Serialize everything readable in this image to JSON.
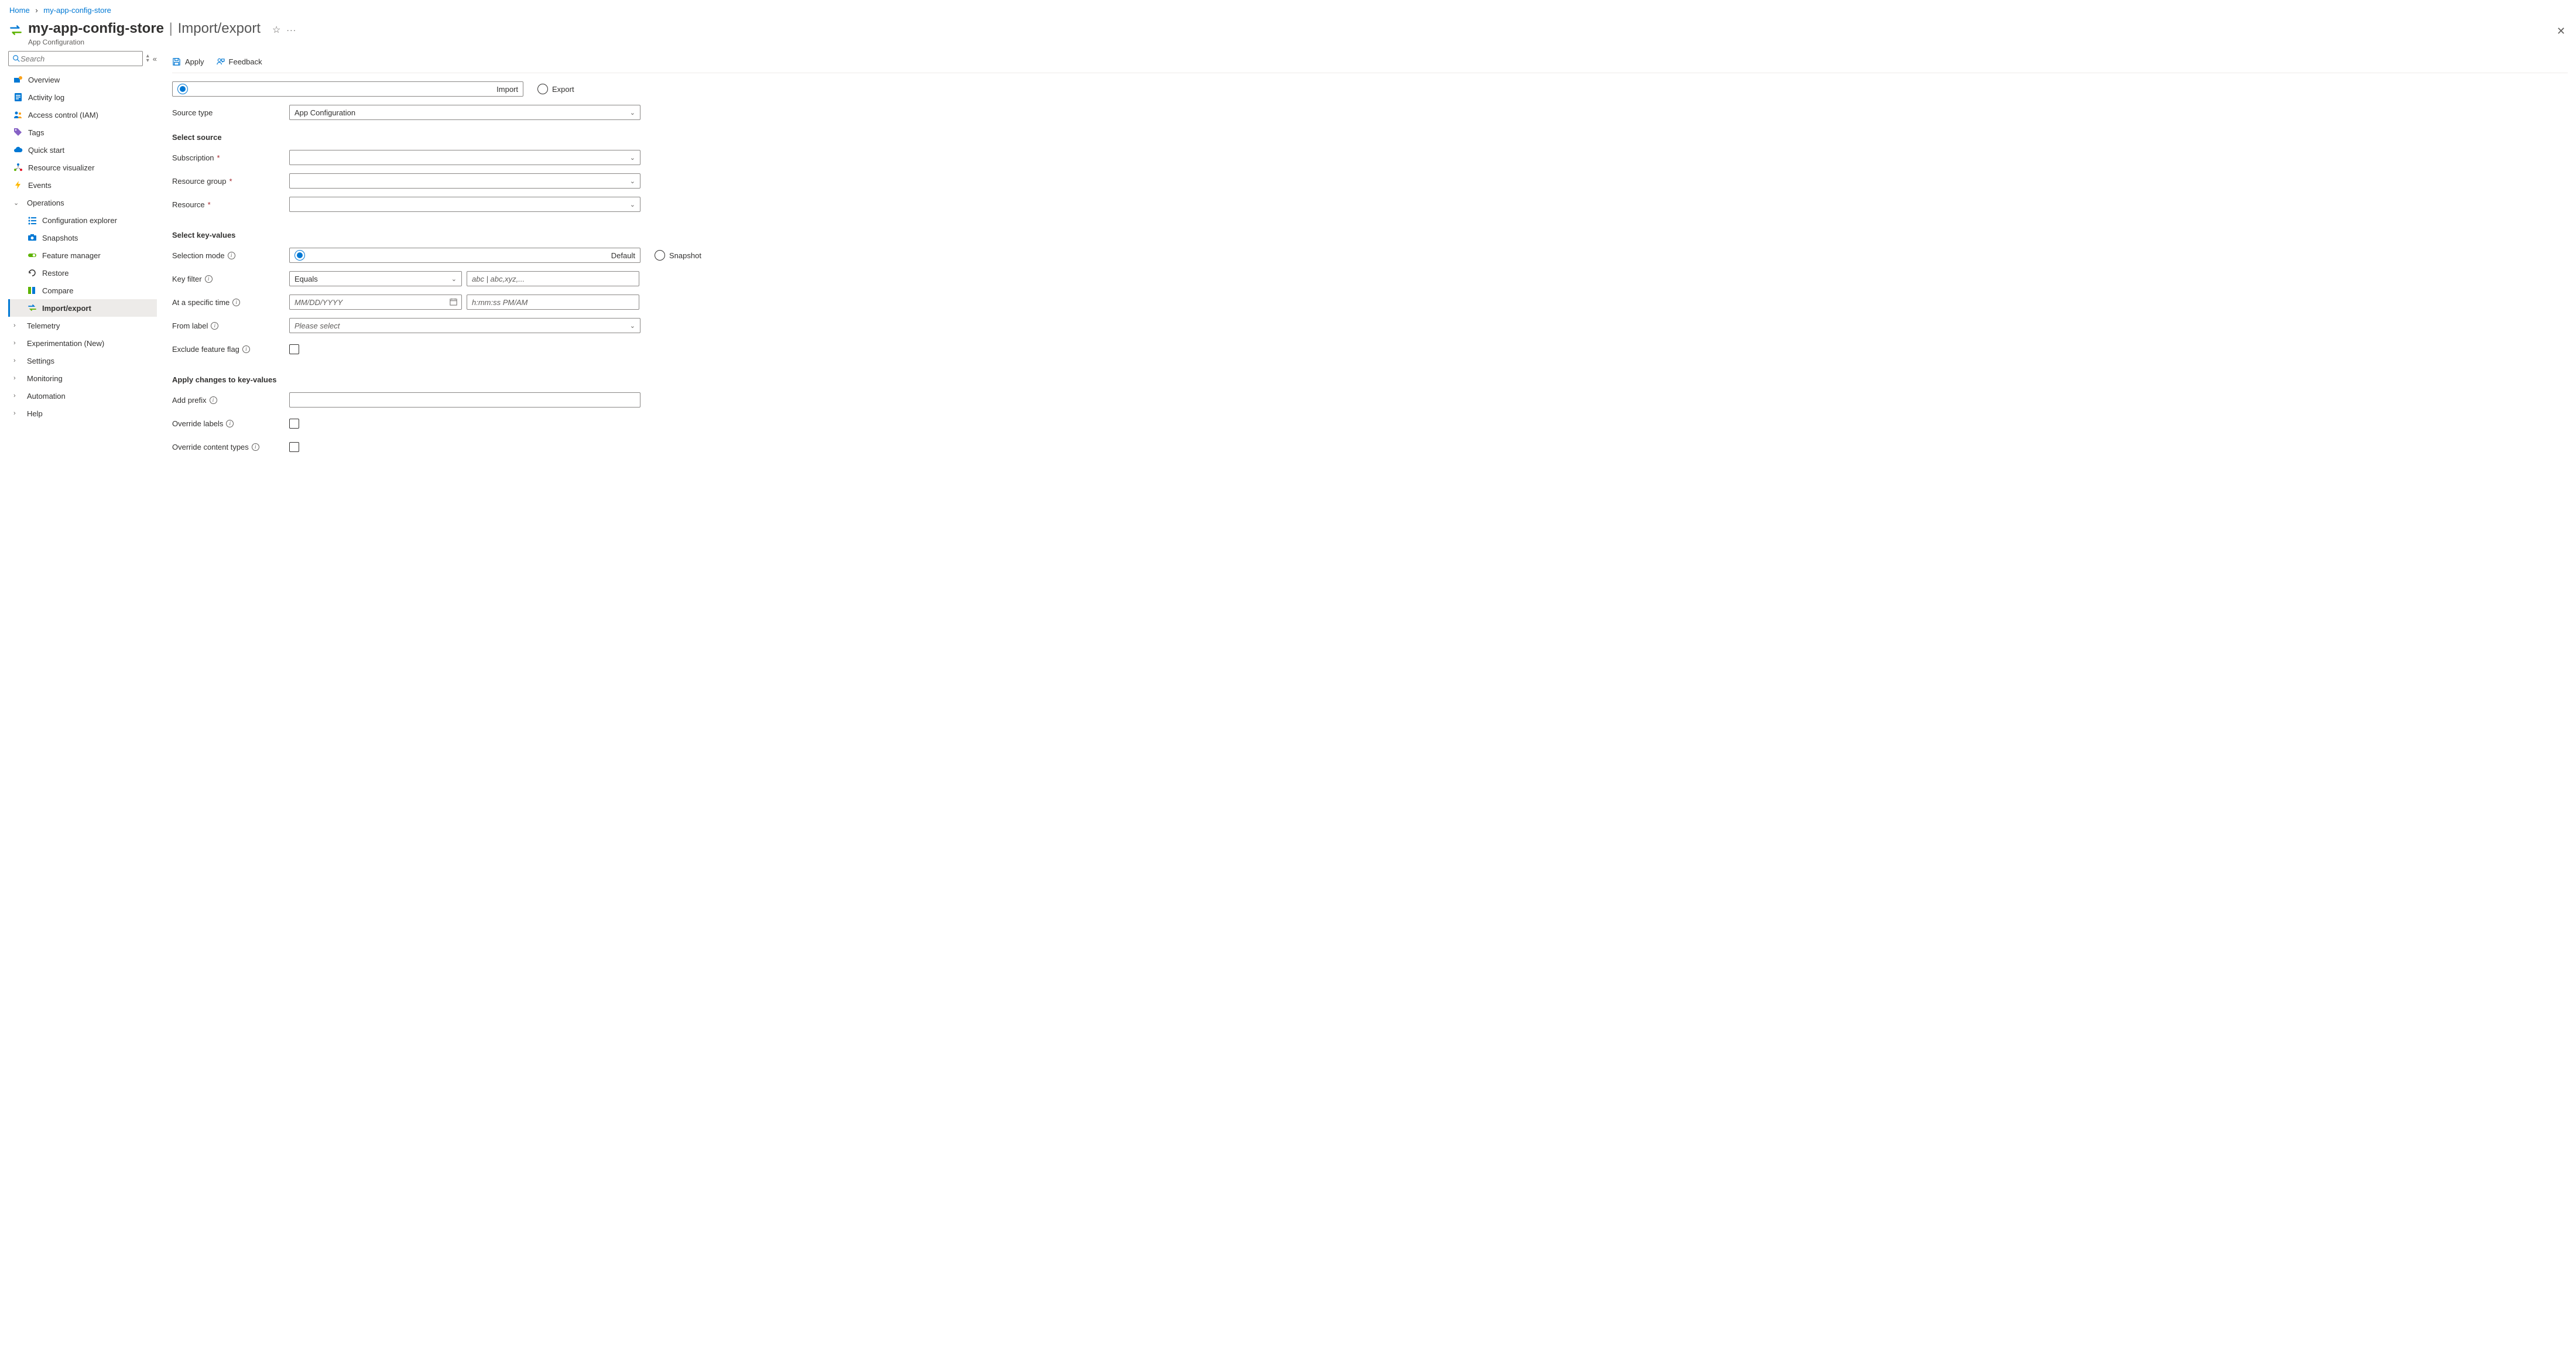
{
  "breadcrumb": {
    "home": "Home",
    "item": "my-app-config-store"
  },
  "header": {
    "resource": "my-app-config-store",
    "page": "Import/export",
    "subtitle": "App Configuration"
  },
  "sidebar": {
    "search_placeholder": "Search",
    "items": {
      "overview": "Overview",
      "activity_log": "Activity log",
      "iam": "Access control (IAM)",
      "tags": "Tags",
      "quick_start": "Quick start",
      "resource_viz": "Resource visualizer",
      "events": "Events",
      "operations": "Operations",
      "config_explorer": "Configuration explorer",
      "snapshots": "Snapshots",
      "feature_manager": "Feature manager",
      "restore": "Restore",
      "compare": "Compare",
      "import_export": "Import/export",
      "telemetry": "Telemetry",
      "experimentation": "Experimentation (New)",
      "settings": "Settings",
      "monitoring": "Monitoring",
      "automation": "Automation",
      "help": "Help"
    }
  },
  "toolbar": {
    "apply": "Apply",
    "feedback": "Feedback"
  },
  "form": {
    "mode_import": "Import",
    "mode_export": "Export",
    "source_type_label": "Source type",
    "source_type_value": "App Configuration",
    "select_source": "Select source",
    "subscription": "Subscription",
    "resource_group": "Resource group",
    "resource": "Resource",
    "select_key_values": "Select key-values",
    "selection_mode": "Selection mode",
    "sm_default": "Default",
    "sm_snapshot": "Snapshot",
    "key_filter": "Key filter",
    "key_filter_op": "Equals",
    "key_filter_ph": "abc | abc,xyz,...",
    "at_time": "At a specific time",
    "date_ph": "MM/DD/YYYY",
    "time_ph": "h:mm:ss PM/AM",
    "from_label": "From label",
    "from_label_ph": "Please select",
    "exclude_ff": "Exclude feature flag",
    "apply_changes": "Apply changes to key-values",
    "add_prefix": "Add prefix",
    "override_labels": "Override labels",
    "override_content": "Override content types"
  }
}
